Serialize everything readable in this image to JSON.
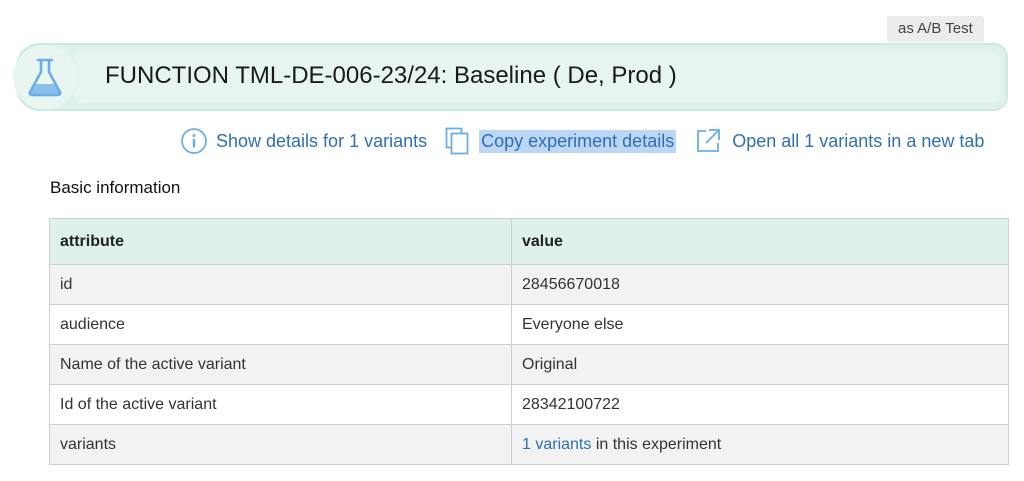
{
  "badge": {
    "label": "as A/B Test"
  },
  "header": {
    "icon": "flask-icon",
    "title": "FUNCTION TML-DE-006-23/24: Baseline ( De, Prod )"
  },
  "actions": {
    "show_details": {
      "icon": "info-icon",
      "label": "Show details for 1 variants"
    },
    "copy_details": {
      "icon": "copy-icon",
      "label": "Copy experiment details"
    },
    "open_all": {
      "icon": "external-link-icon",
      "label": "Open all 1 variants in a new tab"
    }
  },
  "basic_info": {
    "title": "Basic information",
    "columns": [
      "attribute",
      "value"
    ],
    "rows": [
      {
        "attribute": "id",
        "value": "28456670018"
      },
      {
        "attribute": "audience",
        "value": "Everyone else"
      },
      {
        "attribute": "Name of the active variant",
        "value": "Original"
      },
      {
        "attribute": "Id of the active variant",
        "value": "28342100722"
      },
      {
        "attribute": "variants",
        "value_link": "1 variants",
        "value_suffix": " in this experiment"
      }
    ]
  },
  "colors": {
    "accent": "#2f6fb6",
    "header_bg": "#dff2ea",
    "highlight": "#bcd6f5",
    "flask": "#6aaee6"
  }
}
